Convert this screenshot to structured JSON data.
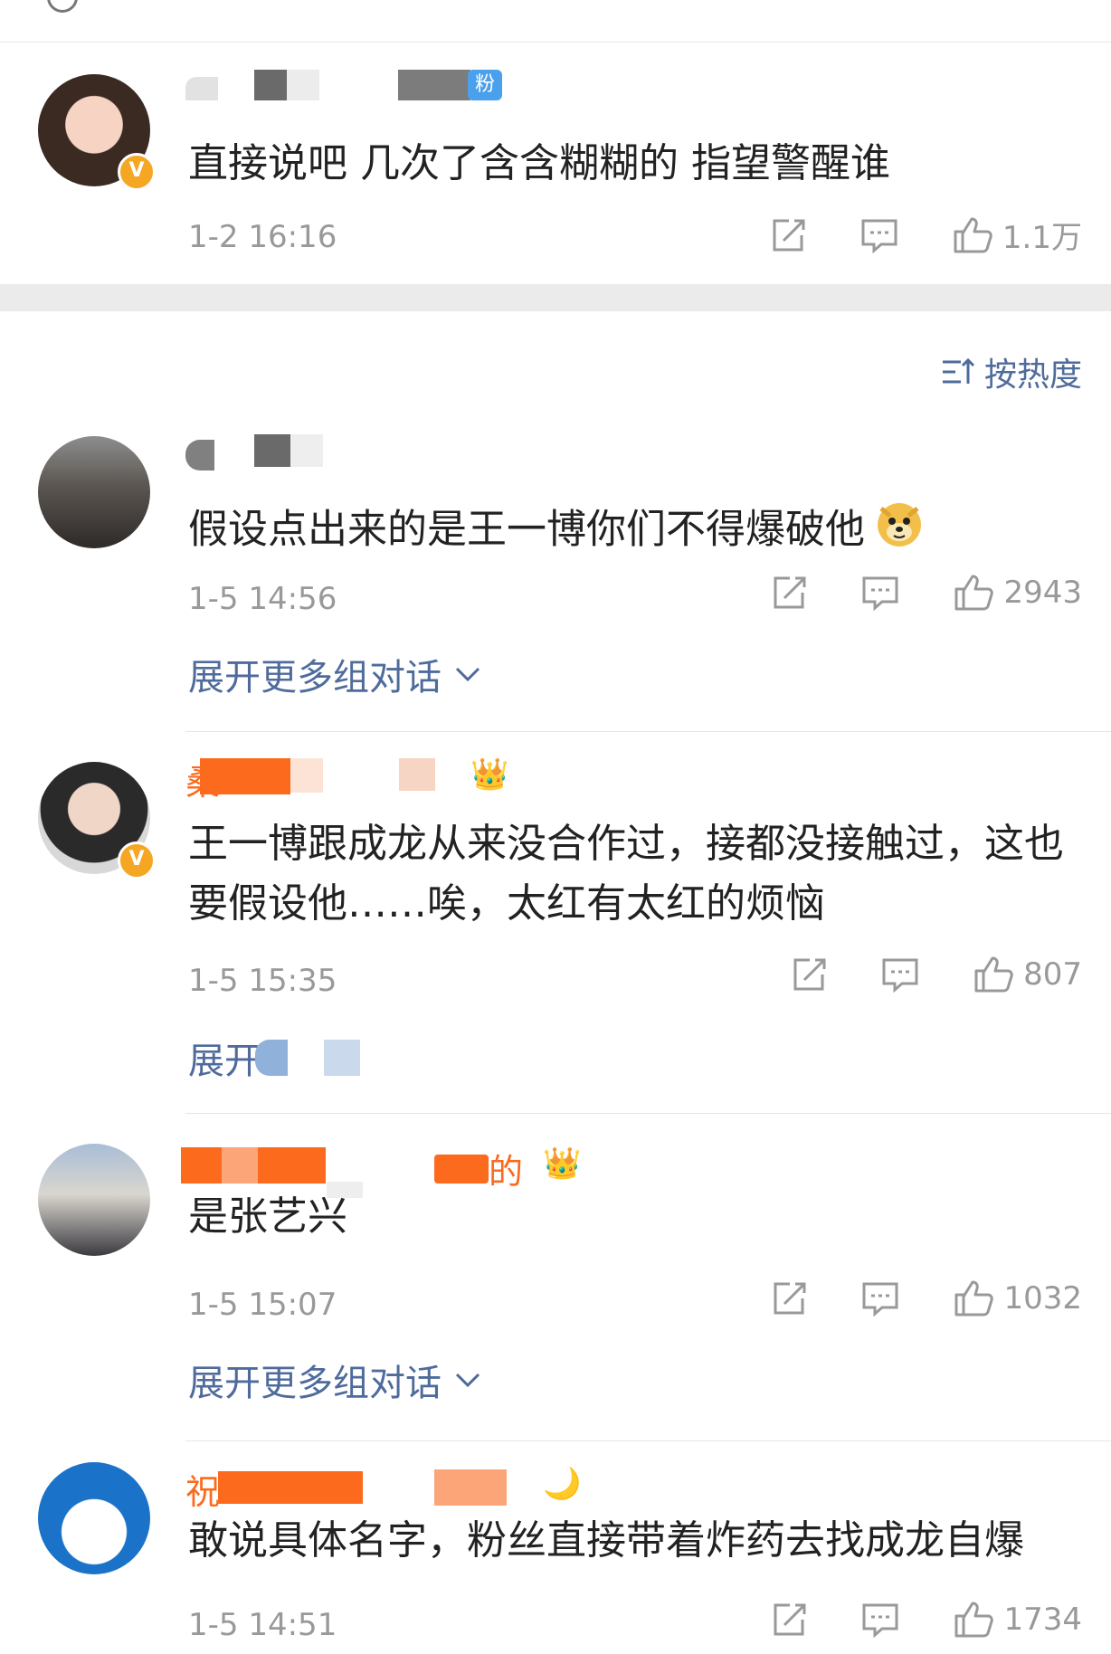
{
  "header": {
    "title": "",
    "back_icon": "back-icon",
    "more_icon": "more-icon"
  },
  "sort": {
    "label": "按热度",
    "icon": "sort-icon"
  },
  "pinned": {
    "badge": "粉",
    "text": "直接说吧 几次了含含糊糊的 指望警醒谁",
    "time": "1-2 16:16",
    "likes": "1.1万"
  },
  "comments": [
    {
      "text": "假设点出来的是王一博你们不得爆破他",
      "emoji": "doge-emoji",
      "time": "1-5 14:56",
      "likes": "2943",
      "expand": "展开更多组对话"
    },
    {
      "name_partial": "桑",
      "text": "王一博跟成龙从来没合作过，接都没接触过，这也要假设他……唉，太红有太红的烦恼",
      "time": "1-5 15:35",
      "likes": "807",
      "expand": "展开"
    },
    {
      "name_partial": "的",
      "text": "是张艺兴",
      "time": "1-5 15:07",
      "likes": "1032",
      "expand": "展开更多组对话"
    },
    {
      "name_partial": "祝",
      "text": "敢说具体名字，粉丝直接带着炸药去找成龙自爆",
      "time": "1-5 14:51",
      "likes": "1734"
    }
  ],
  "colors": {
    "link": "#4f6b9c",
    "meta": "#999999",
    "badge": "#4aa0ea",
    "vip": "#f5a623",
    "name_orange": "#fb6a1d"
  }
}
